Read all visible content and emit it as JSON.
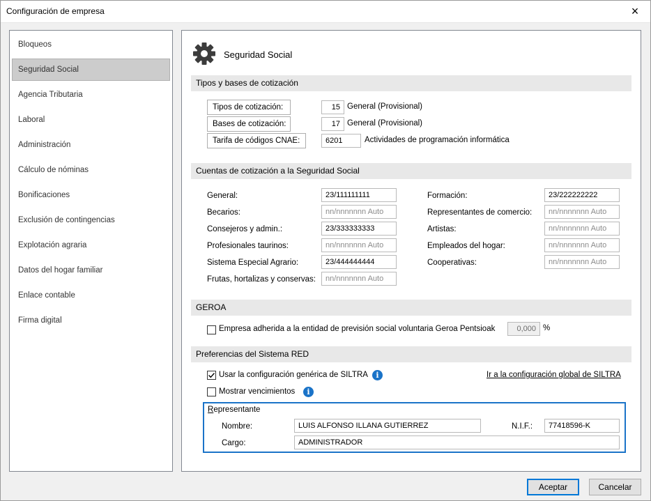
{
  "window": {
    "title": "Configuración de empresa",
    "close_icon": "×"
  },
  "sidebar": {
    "items": [
      {
        "label": "Bloqueos"
      },
      {
        "label": "Seguridad Social",
        "selected": true
      },
      {
        "label": "Agencia Tributaria"
      },
      {
        "label": "Laboral"
      },
      {
        "label": "Administración"
      },
      {
        "label": "Cálculo de nóminas"
      },
      {
        "label": "Bonificaciones"
      },
      {
        "label": "Exclusión de contingencias"
      },
      {
        "label": "Explotación agraria"
      },
      {
        "label": "Datos del hogar familiar"
      },
      {
        "label": "Enlace contable"
      },
      {
        "label": "Firma digital"
      }
    ]
  },
  "page": {
    "title": "Seguridad Social",
    "icon": "gear-icon"
  },
  "tipos": {
    "header": "Tipos y bases de cotización",
    "tipos_label": "Tipos de cotización:",
    "tipos_value": "15",
    "tipos_desc": "General (Provisional)",
    "bases_label": "Bases de cotización:",
    "bases_value": "17",
    "bases_desc": "General (Provisional)",
    "cnae_label": "Tarifa de códigos CNAE:",
    "cnae_value": "6201",
    "cnae_desc": "Actividades de programación informática"
  },
  "cuentas": {
    "header": "Cuentas de cotización a la Seguridad Social",
    "left": [
      {
        "label": "General:",
        "value": "23/111111111",
        "placeholder": false
      },
      {
        "label": "Becarios:",
        "value": "nn/nnnnnnn Auto",
        "placeholder": true
      },
      {
        "label": "Consejeros y admin.:",
        "value": "23/333333333",
        "placeholder": false
      },
      {
        "label": "Profesionales taurinos:",
        "value": "nn/nnnnnnn Auto",
        "placeholder": true
      },
      {
        "label": "Sistema Especial Agrario:",
        "value": "23/444444444",
        "placeholder": false
      },
      {
        "label": "Frutas, hortalizas y conservas:",
        "value": "nn/nnnnnnn Auto",
        "placeholder": true
      }
    ],
    "right": [
      {
        "label": "Formación:",
        "value": "23/222222222",
        "placeholder": false
      },
      {
        "label": "Representantes de comercio:",
        "value": "nn/nnnnnnn Auto",
        "placeholder": true
      },
      {
        "label": "Artistas:",
        "value": "nn/nnnnnnn Auto",
        "placeholder": true
      },
      {
        "label": "Empleados del hogar:",
        "value": "nn/nnnnnnn Auto",
        "placeholder": true
      },
      {
        "label": "Cooperativas:",
        "value": "nn/nnnnnnn Auto",
        "placeholder": true
      }
    ]
  },
  "geroa": {
    "header": "GEROA",
    "checkbox_label": "Empresa adherida a la entidad de previsión social voluntaria Geroa Pentsioak",
    "checked": false,
    "percent_value": "0,000",
    "percent_sign": "%"
  },
  "red": {
    "header": "Preferencias del Sistema RED",
    "usar_label": "Usar la configuración genérica de SILTRA",
    "usar_checked": true,
    "mostrar_label": "Mostrar vencimientos",
    "mostrar_checked": false,
    "link_label": "Ir a la configuración global de SILTRA",
    "info_glyph": "i"
  },
  "representante": {
    "legend": "Representante",
    "nombre_label": "Nombre:",
    "nombre_value": "LUIS ALFONSO ILLANA GUTIERREZ",
    "nif_label": "N.I.F.:",
    "nif_value": "77418596-K",
    "cargo_label": "Cargo:",
    "cargo_value": "ADMINISTRADOR"
  },
  "footer": {
    "accept_label": "Aceptar",
    "cancel_label": "Cancelar"
  },
  "colors": {
    "accent": "#1a73c8",
    "selected_bg": "#cccccc"
  }
}
